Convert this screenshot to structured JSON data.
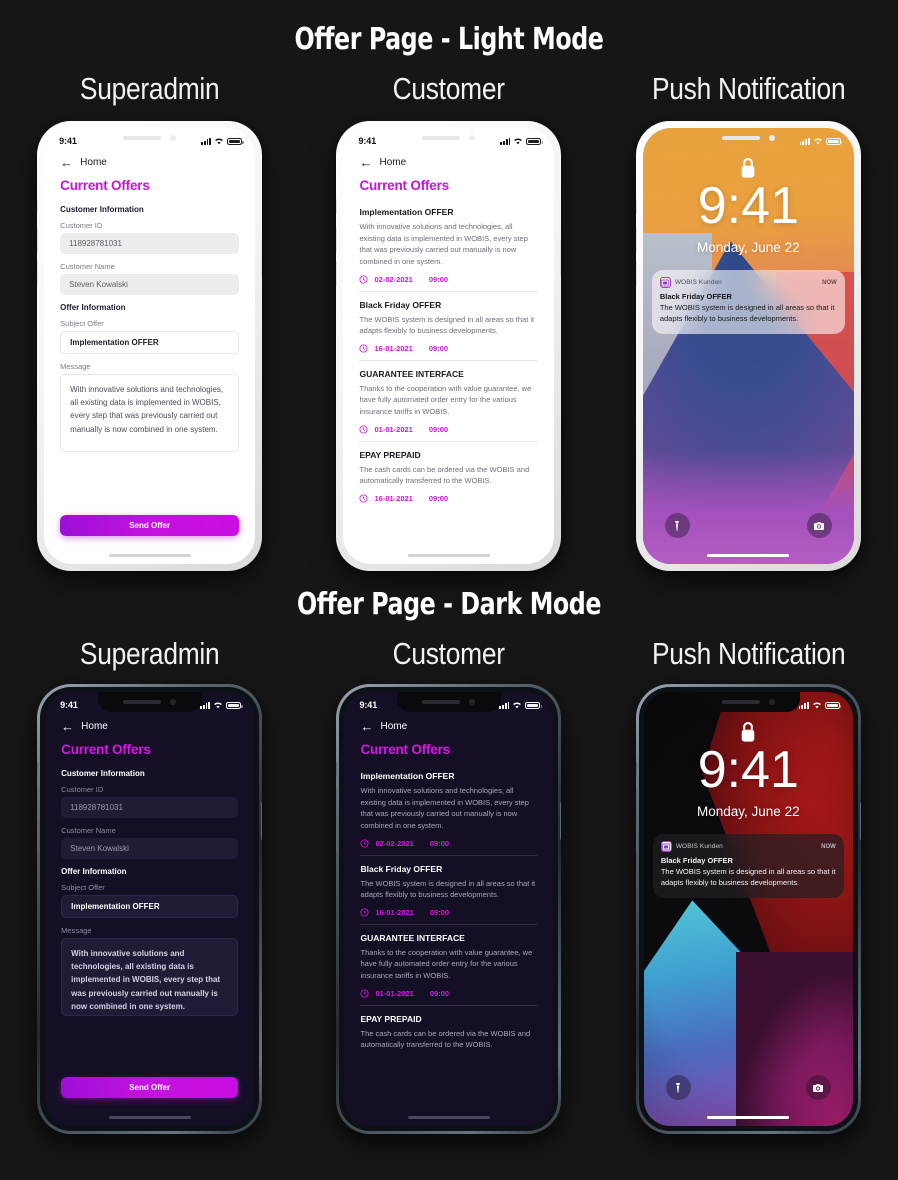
{
  "sections": [
    {
      "heading": "Offer Page - Light Mode",
      "columns": [
        "Superadmin",
        "Customer",
        "Push Notification"
      ]
    },
    {
      "heading": "Offer Page - Dark Mode",
      "columns": [
        "Superadmin",
        "Customer",
        "Push Notification"
      ]
    }
  ],
  "status_bar": {
    "time": "9:41",
    "signal_icon": "cellular-bars-icon",
    "wifi_icon": "wifi-icon",
    "battery_icon": "battery-icon"
  },
  "superadmin": {
    "back_icon": "arrow-left-icon",
    "nav_label": "Home",
    "page_title": "Current Offers",
    "customer_section_title": "Customer Information",
    "customer_id_label": "Customer ID",
    "customer_id_value": "118928781031",
    "customer_name_label": "Customer Name",
    "customer_name_value": "Steven Kowalski",
    "offer_section_title": "Offer Information",
    "subject_label": "Subject Offer",
    "subject_value": "Implementation OFFER",
    "message_label": "Message",
    "message_value": "With innovative solutions and technologies, all existing data is implemented in WOBIS, every step that was previously carried out manually is now combined in one system.",
    "send_button": "Send Offer"
  },
  "customer": {
    "back_icon": "arrow-left-icon",
    "nav_label": "Home",
    "page_title": "Current Offers",
    "clock_icon": "clock-icon",
    "offers": [
      {
        "title": "Implementation OFFER",
        "body": "With innovative solutions and technologies, all existing data is implemented in WOBIS, every step that was previously carried out manually is now combined in one system.",
        "date": "02-02-2021",
        "time": "09:00"
      },
      {
        "title": "Black Friday OFFER",
        "body": "The WOBIS system is designed in all areas so that it adapts flexibly to business developments.",
        "date": "16-01-2021",
        "time": "09:00"
      },
      {
        "title": "GUARANTEE INTERFACE",
        "body": "Thanks to the cooperation with value guarantee, we have fully automated order entry for the various insurance tariffs in WOBIS.",
        "date": "01-01-2021",
        "time": "09:00"
      },
      {
        "title": "EPAY PREPAID",
        "body": "The cash cards can be ordered via the WOBIS and automatically transferred to the WOBIS.",
        "date": "16-01-2021",
        "time": "09:00"
      }
    ]
  },
  "lockscreen": {
    "lock_icon": "lock-icon",
    "time": "9:41",
    "date": "Monday, June 22",
    "notification": {
      "app_icon": "wobis-app-icon",
      "app_name": "WOBIS Kunden",
      "timestamp": "NOW",
      "title": "Black Friday OFFER",
      "body": "The WOBIS system is designed in all areas so that it adapts flexibly to business developments."
    },
    "flashlight_icon": "flashlight-icon",
    "camera_icon": "camera-icon"
  },
  "colors": {
    "page_background": "#161616",
    "accent_magenta": "#cb12d8",
    "dark_app_background": "#140f24",
    "light_app_background": "#ffffff",
    "send_button_gradient_start": "#9c0fd6",
    "send_button_gradient_end": "#c90ce0"
  }
}
